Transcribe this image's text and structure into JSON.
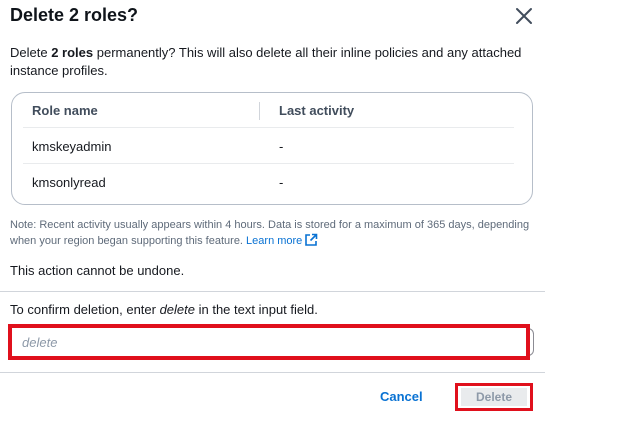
{
  "modal": {
    "title": "Delete 2 roles?",
    "desc_pre": "Delete ",
    "desc_bold": "2 roles",
    "desc_post": " permanently? This will also delete all their inline policies and any attached instance profiles."
  },
  "table": {
    "headers": [
      "Role name",
      "Last activity"
    ],
    "rows": [
      {
        "role": "kmskeyadmin",
        "activity": "-"
      },
      {
        "role": "kmsonlyread",
        "activity": "-"
      }
    ]
  },
  "note": {
    "text": "Note: Recent activity usually appears within 4 hours. Data is stored for a maximum of 365 days, depending when your region began supporting this feature. ",
    "link": "Learn more"
  },
  "warning": "This action cannot be undone.",
  "confirm": {
    "pre": "To confirm deletion, enter ",
    "keyword": "delete",
    "post": " in the text input field.",
    "placeholder": "delete",
    "value": ""
  },
  "buttons": {
    "cancel": "Cancel",
    "delete": "Delete"
  },
  "colors": {
    "link": "#0972d3",
    "highlight": "#e0101c",
    "disabled_bg": "#e9ebed"
  }
}
